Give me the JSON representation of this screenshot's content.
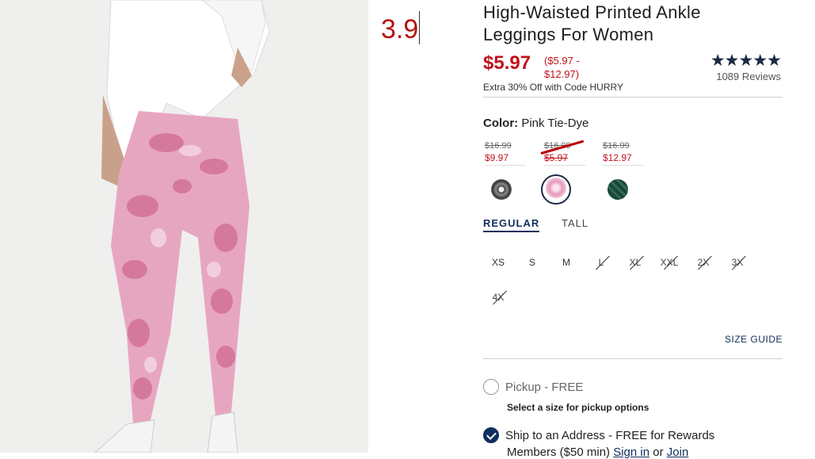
{
  "typed_value": "3.9",
  "product": {
    "title_line1": "High-Waisted Printed Ankle",
    "title_line2": "Leggings For Women",
    "sale_price": "$5.97",
    "price_range_line1": "($5.97 -",
    "price_range_line2": "$12.97)",
    "promo": "Extra 30% Off with Code HURRY",
    "rating_stars": "★★★★★",
    "reviews": "1089 Reviews"
  },
  "color": {
    "label": "Color:",
    "value": "Pink Tie-Dye",
    "swatches": [
      {
        "was": "$16.99",
        "now": "$9.97",
        "fill": "#555555",
        "selected": false
      },
      {
        "was": "$16.99",
        "now": "$5.97",
        "fill": "#e8a9c3",
        "selected": true
      },
      {
        "was": "$16.99",
        "now": "$12.97",
        "fill": "#1f4a3a",
        "selected": false
      }
    ]
  },
  "fit": {
    "regular": "REGULAR",
    "tall": "TALL"
  },
  "sizes": [
    "XS",
    "S",
    "M",
    "L",
    "XL",
    "XXL",
    "2X",
    "3X",
    "4X"
  ],
  "size_guide": "SIZE GUIDE",
  "shipping": {
    "pickup_label": "Pickup - FREE",
    "pickup_note": "Select a size for pickup options",
    "ship_label": "Ship to an Address - FREE for Rewards",
    "ship_line2_prefix": "Members ($50 min)",
    "sign_in": "Sign in",
    "or": "or",
    "join": "Join"
  },
  "colors": {
    "sale": "#c1121c",
    "navy": "#0f2f5c"
  }
}
